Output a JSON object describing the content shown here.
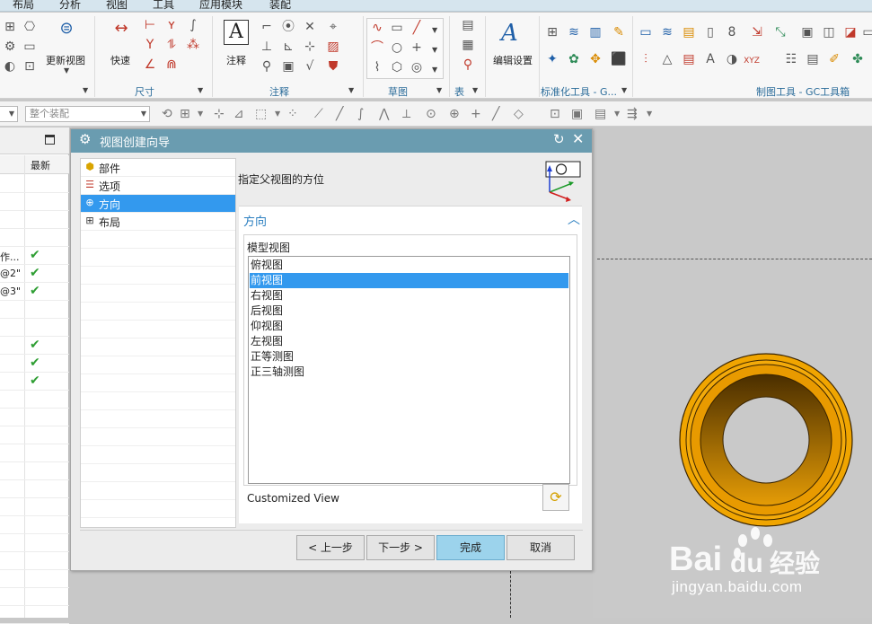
{
  "menu": {
    "items": [
      "布局",
      "分析",
      "视图",
      "工具",
      "应用模块",
      "装配"
    ]
  },
  "ribbon": {
    "update_views_label": "更新视图",
    "quick_label": "快速",
    "annotation_label": "注释",
    "edit_settings_label": "编辑设置",
    "groups": {
      "dimension": "尺寸",
      "annotation": "注释",
      "sketch": "草图",
      "table": "表",
      "standard_tools": "标准化工具 - G...",
      "drafting_tools": "制图工具 - GC工具箱"
    }
  },
  "toolbar2": {
    "assembly_combo": "整个装配"
  },
  "navigator": {
    "column_latest": "最新",
    "rows": [
      {
        "text": "",
        "checked": false
      },
      {
        "text": "",
        "checked": false
      },
      {
        "text": "",
        "checked": false
      },
      {
        "text": "",
        "checked": false
      },
      {
        "text": "作...",
        "checked": true
      },
      {
        "text": "@2\"",
        "checked": true
      },
      {
        "text": "@3\"",
        "checked": true
      },
      {
        "text": "",
        "checked": false
      },
      {
        "text": "",
        "checked": false
      },
      {
        "text": "",
        "checked": true
      },
      {
        "text": "",
        "checked": true
      },
      {
        "text": "",
        "checked": true
      }
    ]
  },
  "dialog": {
    "title": "视图创建向导",
    "steps": [
      {
        "label": "部件",
        "icon": "cube-icon",
        "selected": false
      },
      {
        "label": "选项",
        "icon": "options-icon",
        "selected": false
      },
      {
        "label": "方向",
        "icon": "orientation-icon",
        "selected": true
      },
      {
        "label": "布局",
        "icon": "layout-grid-icon",
        "selected": false
      }
    ],
    "instruction": "指定父视图的方位",
    "group_title": "方向",
    "model_views_label": "模型视图",
    "model_views": [
      {
        "label": "俯视图",
        "selected": false
      },
      {
        "label": "前视图",
        "selected": true
      },
      {
        "label": "右视图",
        "selected": false
      },
      {
        "label": "后视图",
        "selected": false
      },
      {
        "label": "仰视图",
        "selected": false
      },
      {
        "label": "左视图",
        "selected": false
      },
      {
        "label": "正等测图",
        "selected": false
      },
      {
        "label": "正三轴测图",
        "selected": false
      }
    ],
    "custom_view_label": "Customized View",
    "buttons": {
      "back": "< 上一步",
      "next": "下一步 >",
      "finish": "完成",
      "cancel": "取消"
    }
  },
  "colors": {
    "title_bar": "#6a9cb0",
    "selection": "#3399ee",
    "finish_button": "#9cd3ec",
    "part_gold": "#f0a500",
    "check_green": "#2e9e33"
  },
  "watermark": {
    "logo": "Bai du 经验",
    "url": "jingyan.baidu.com"
  }
}
